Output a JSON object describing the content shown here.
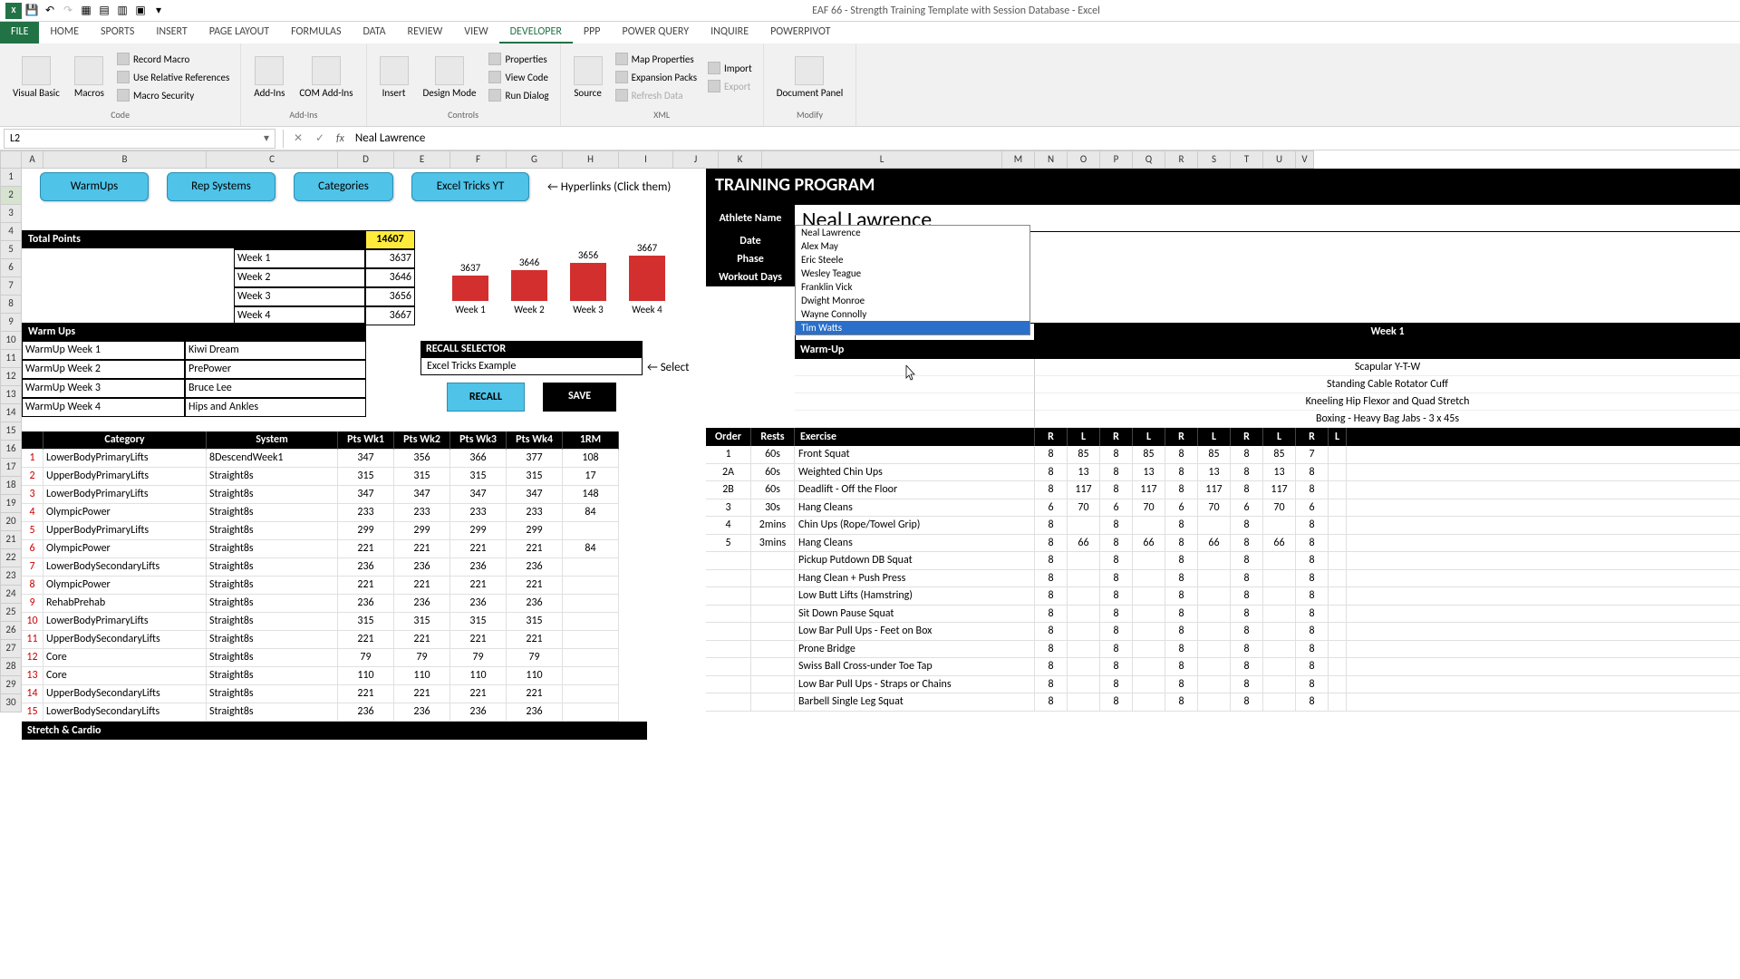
{
  "title": "EAF 66 - Strength Training Template with Session Database - Excel",
  "tabs": [
    "FILE",
    "HOME",
    "SPORTS",
    "INSERT",
    "PAGE LAYOUT",
    "FORMULAS",
    "DATA",
    "REVIEW",
    "VIEW",
    "DEVELOPER",
    "PPP",
    "POWER QUERY",
    "INQUIRE",
    "POWERPIVOT"
  ],
  "active_tab": "DEVELOPER",
  "ribbon": {
    "code": {
      "label": "Code",
      "big": [
        "Visual Basic",
        "Macros"
      ],
      "small": [
        "Record Macro",
        "Use Relative References",
        "Macro Security"
      ]
    },
    "addins": {
      "label": "Add-Ins",
      "big": [
        "Add-Ins",
        "COM Add-Ins"
      ]
    },
    "controls": {
      "label": "Controls",
      "big": [
        "Insert",
        "Design Mode"
      ],
      "small": [
        "Properties",
        "View Code",
        "Run Dialog"
      ]
    },
    "xml": {
      "label": "XML",
      "big": [
        "Source"
      ],
      "small": [
        "Map Properties",
        "Expansion Packs",
        "Refresh Data",
        "Import",
        "Export"
      ]
    },
    "modify": {
      "label": "Modify",
      "big": [
        "Document Panel"
      ]
    }
  },
  "name_box": "L2",
  "formula_value": "Neal Lawrence",
  "columns": [
    "A",
    "B",
    "C",
    "D",
    "E",
    "F",
    "G",
    "H",
    "I",
    "J",
    "K",
    "L",
    "M",
    "N",
    "O",
    "P",
    "Q",
    "R",
    "S",
    "T",
    "U",
    "V"
  ],
  "row_count": 30,
  "buttons": {
    "warmups": "WarmUps",
    "repsystems": "Rep Systems",
    "categories": "Categories",
    "yttricks": "Excel Tricks YT"
  },
  "hyperlinks_label": "← Hyperlinks (Click them)",
  "total_points": {
    "label": "Total Points",
    "value": "14607",
    "weeks": [
      [
        "Week 1",
        "3637"
      ],
      [
        "Week 2",
        "3646"
      ],
      [
        "Week 3",
        "3656"
      ],
      [
        "Week 4",
        "3667"
      ]
    ]
  },
  "warmups": {
    "label": "Warm Ups",
    "rows": [
      [
        "WarmUp Week 1",
        "Kiwi Dream"
      ],
      [
        "WarmUp Week 2",
        "PrePower"
      ],
      [
        "WarmUp Week 3",
        "Bruce Lee"
      ],
      [
        "WarmUp Week 4",
        "Hips and Ankles"
      ]
    ]
  },
  "chart_data": {
    "type": "bar",
    "categories": [
      "Week 1",
      "Week 2",
      "Week 3",
      "Week 4"
    ],
    "values": [
      3637,
      3646,
      3656,
      3667
    ],
    "ylim": [
      3600,
      3700
    ]
  },
  "recall": {
    "title": "RECALL SELECTOR",
    "value": "Excel Tricks Example",
    "select_label": "← Select",
    "btn_recall": "RECALL",
    "btn_save": "SAVE"
  },
  "category_header": [
    "Category",
    "System",
    "Pts Wk1",
    "Pts Wk2",
    "Pts Wk3",
    "Pts Wk4",
    "1RM"
  ],
  "category_rows": [
    [
      "1",
      "LowerBodyPrimaryLifts",
      "8DescendWeek1",
      "347",
      "356",
      "366",
      "377",
      "108"
    ],
    [
      "2",
      "UpperBodyPrimaryLifts",
      "Straight8s",
      "315",
      "315",
      "315",
      "315",
      "17"
    ],
    [
      "3",
      "LowerBodyPrimaryLifts",
      "Straight8s",
      "347",
      "347",
      "347",
      "347",
      "148"
    ],
    [
      "4",
      "OlympicPower",
      "Straight8s",
      "233",
      "233",
      "233",
      "233",
      "84"
    ],
    [
      "5",
      "UpperBodyPrimaryLifts",
      "Straight8s",
      "299",
      "299",
      "299",
      "299",
      ""
    ],
    [
      "6",
      "OlympicPower",
      "Straight8s",
      "221",
      "221",
      "221",
      "221",
      "84"
    ],
    [
      "7",
      "LowerBodySecondaryLifts",
      "Straight8s",
      "236",
      "236",
      "236",
      "236",
      ""
    ],
    [
      "8",
      "OlympicPower",
      "Straight8s",
      "221",
      "221",
      "221",
      "221",
      ""
    ],
    [
      "9",
      "RehabPrehab",
      "Straight8s",
      "236",
      "236",
      "236",
      "236",
      ""
    ],
    [
      "10",
      "LowerBodyPrimaryLifts",
      "Straight8s",
      "315",
      "315",
      "315",
      "315",
      ""
    ],
    [
      "11",
      "UpperBodySecondaryLifts",
      "Straight8s",
      "221",
      "221",
      "221",
      "221",
      ""
    ],
    [
      "12",
      "Core",
      "Straight8s",
      "79",
      "79",
      "79",
      "79",
      ""
    ],
    [
      "13",
      "Core",
      "Straight8s",
      "110",
      "110",
      "110",
      "110",
      ""
    ],
    [
      "14",
      "UpperBodySecondaryLifts",
      "Straight8s",
      "221",
      "221",
      "221",
      "221",
      ""
    ],
    [
      "15",
      "LowerBodySecondaryLifts",
      "Straight8s",
      "236",
      "236",
      "236",
      "236",
      ""
    ]
  ],
  "stretch_label": "Stretch & Cardio",
  "tp_title": "TRAINING PROGRAM",
  "labels": {
    "athlete": "Athlete Name",
    "date": "Date",
    "phase": "Phase",
    "days": "Workout Days"
  },
  "athlete_name": "Neal Lawrence",
  "dropdown": [
    "Neal Lawrence",
    "Alex May",
    "Eric Steele",
    "Wesley Teague",
    "Franklin Vick",
    "Dwight Monroe",
    "Wayne Connolly",
    "Tim Watts"
  ],
  "dropdown_highlight": "Tim Watts",
  "week_label": "Week 1",
  "warmup_label": "Warm-Up",
  "warmup_items": [
    "Scapular Y-T-W",
    "Standing Cable Rotator Cuff",
    "Kneeling Hip Flexor and Quad Stretch",
    "Boxing - Heavy Bag Jabs - 3 x 45s"
  ],
  "ex_header": [
    "Order",
    "Rests",
    "Exercise",
    "R",
    "L",
    "R",
    "L",
    "R",
    "L",
    "R",
    "L",
    "R",
    "L"
  ],
  "ex_rows": [
    [
      "1",
      "60s",
      "Front Squat",
      "8",
      "85",
      "8",
      "85",
      "8",
      "85",
      "8",
      "85",
      "7",
      ""
    ],
    [
      "2A",
      "60s",
      "Weighted Chin Ups",
      "8",
      "13",
      "8",
      "13",
      "8",
      "13",
      "8",
      "13",
      "8",
      ""
    ],
    [
      "2B",
      "60s",
      "Deadlift - Off the Floor",
      "8",
      "117",
      "8",
      "117",
      "8",
      "117",
      "8",
      "117",
      "8",
      ""
    ],
    [
      "3",
      "30s",
      "Hang Cleans",
      "6",
      "70",
      "6",
      "70",
      "6",
      "70",
      "6",
      "70",
      "6",
      ""
    ],
    [
      "4",
      "2mins",
      "Chin Ups (Rope/Towel Grip)",
      "8",
      "",
      "8",
      "",
      "8",
      "",
      "8",
      "",
      "8",
      ""
    ],
    [
      "5",
      "3mins",
      "Hang Cleans",
      "8",
      "66",
      "8",
      "66",
      "8",
      "66",
      "8",
      "66",
      "8",
      ""
    ],
    [
      "",
      "",
      "Pickup Putdown DB Squat",
      "8",
      "",
      "8",
      "",
      "8",
      "",
      "8",
      "",
      "8",
      ""
    ],
    [
      "",
      "",
      "Hang Clean + Push Press",
      "8",
      "",
      "8",
      "",
      "8",
      "",
      "8",
      "",
      "8",
      ""
    ],
    [
      "",
      "",
      "Low Butt Lifts (Hamstring)",
      "8",
      "",
      "8",
      "",
      "8",
      "",
      "8",
      "",
      "8",
      ""
    ],
    [
      "",
      "",
      "Sit Down Pause Squat",
      "8",
      "",
      "8",
      "",
      "8",
      "",
      "8",
      "",
      "8",
      ""
    ],
    [
      "",
      "",
      "Low Bar Pull Ups - Feet on Box",
      "8",
      "",
      "8",
      "",
      "8",
      "",
      "8",
      "",
      "8",
      ""
    ],
    [
      "",
      "",
      "Prone Bridge",
      "8",
      "",
      "8",
      "",
      "8",
      "",
      "8",
      "",
      "8",
      ""
    ],
    [
      "",
      "",
      "Swiss Ball Cross-under Toe Tap",
      "8",
      "",
      "8",
      "",
      "8",
      "",
      "8",
      "",
      "8",
      ""
    ],
    [
      "",
      "",
      "Low Bar Pull Ups - Straps or Chains",
      "8",
      "",
      "8",
      "",
      "8",
      "",
      "8",
      "",
      "8",
      ""
    ],
    [
      "",
      "",
      "Barbell Single Leg Squat",
      "8",
      "",
      "8",
      "",
      "8",
      "",
      "8",
      "",
      "8",
      ""
    ]
  ]
}
